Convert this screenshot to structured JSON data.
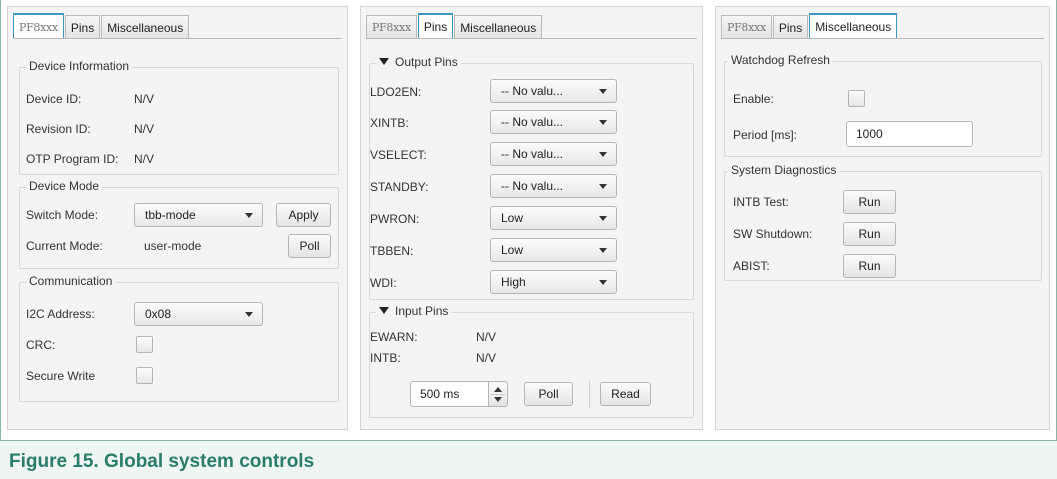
{
  "caption": "Figure 15.  Global system controls",
  "tabs": {
    "logo": "PF8xxx",
    "pins": "Pins",
    "misc": "Miscellaneous"
  },
  "device_panel": {
    "device_info": {
      "title": "Device Information",
      "device_id_label": "Device ID:",
      "device_id_value": "N/V",
      "revision_id_label": "Revision ID:",
      "revision_id_value": "N/V",
      "otp_label": "OTP Program ID:",
      "otp_value": "N/V"
    },
    "device_mode": {
      "title": "Device Mode",
      "switch_mode_label": "Switch Mode:",
      "switch_mode_value": "tbb-mode",
      "apply_label": "Apply",
      "current_mode_label": "Current Mode:",
      "current_mode_value": "user-mode",
      "poll_label": "Poll"
    },
    "communication": {
      "title": "Communication",
      "i2c_label": "I2C Address:",
      "i2c_value": "0x08",
      "crc_label": "CRC:",
      "secure_write_label": "Secure Write"
    }
  },
  "pins_panel": {
    "output_pins_title": "Output Pins",
    "output_pins": [
      {
        "label": "LDO2EN:",
        "value": "-- No valu..."
      },
      {
        "label": "XINTB:",
        "value": "-- No valu..."
      },
      {
        "label": "VSELECT:",
        "value": "-- No valu..."
      },
      {
        "label": "STANDBY:",
        "value": "-- No valu..."
      },
      {
        "label": "PWRON:",
        "value": "Low"
      },
      {
        "label": "TBBEN:",
        "value": "Low"
      },
      {
        "label": "WDI:",
        "value": "High"
      }
    ],
    "input_pins_title": "Input Pins",
    "input_pins": [
      {
        "label": "EWARN:",
        "value": "N/V"
      },
      {
        "label": "INTB:",
        "value": "N/V"
      }
    ],
    "interval_value": "500 ms",
    "poll_label": "Poll",
    "read_label": "Read"
  },
  "misc_panel": {
    "watchdog": {
      "title": "Watchdog Refresh",
      "enable_label": "Enable:",
      "period_label": "Period [ms]:",
      "period_value": "1000"
    },
    "diagnostics": {
      "title": "System Diagnostics",
      "items": [
        {
          "label": "INTB Test:",
          "button": "Run"
        },
        {
          "label": "SW Shutdown:",
          "button": "Run"
        },
        {
          "label": "ABIST:",
          "button": "Run"
        }
      ]
    }
  }
}
